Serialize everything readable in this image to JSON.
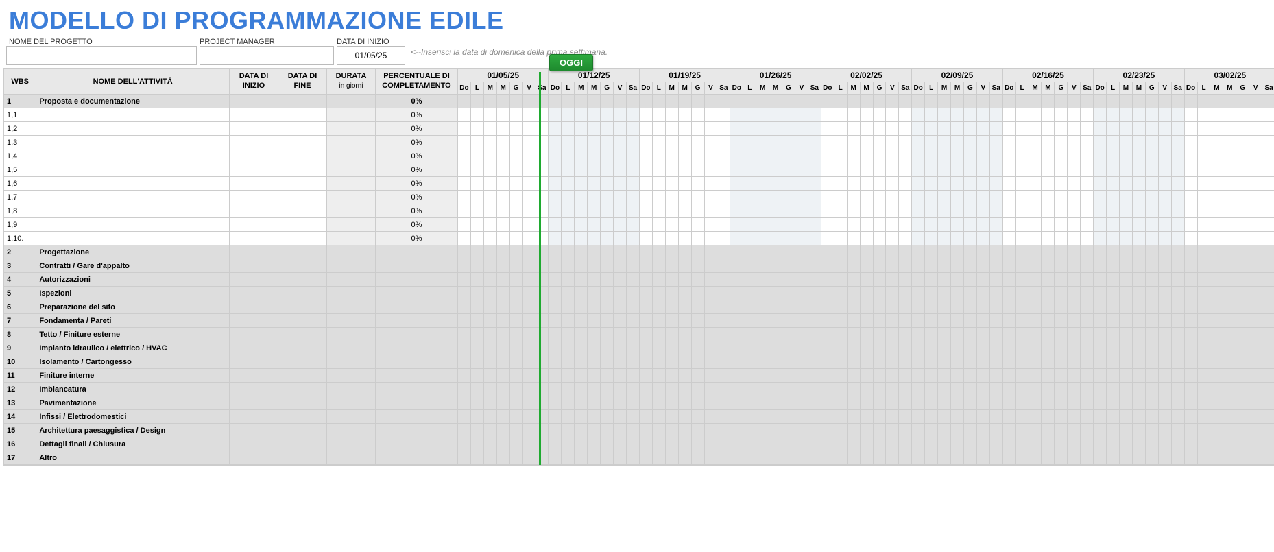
{
  "title": "MODELLO DI PROGRAMMAZIONE EDILE",
  "meta": {
    "project_name_label": "NOME DEL PROGETTO",
    "pm_label": "PROJECT MANAGER",
    "start_date_label": "DATA DI INIZIO",
    "project_name": "",
    "pm": "",
    "start_date": "01/05/25",
    "hint": "<--Inserisci la data di domenica della prima settimana."
  },
  "today_label": "OGGI",
  "headers": {
    "wbs": "WBS",
    "task": "NOME DELL'ATTIVITÀ",
    "start": "DATA DI INIZIO",
    "end": "DATA DI FINE",
    "dur_top": "DURATA",
    "dur_sub": "in giorni",
    "pct": "PERCENTUALE DI COMPLETAMENTO"
  },
  "weeks": [
    "01/05/25",
    "01/12/25",
    "01/19/25",
    "01/26/25",
    "02/02/25",
    "02/09/25",
    "02/16/25",
    "02/23/25",
    "03/02/25"
  ],
  "days": [
    "Do",
    "L",
    "M",
    "M",
    "G",
    "V",
    "Sa"
  ],
  "rows": [
    {
      "wbs": "1",
      "task": "Proposta e documentazione",
      "pct": "0%",
      "group": true
    },
    {
      "wbs": "1,1",
      "task": "",
      "pct": "0%",
      "group": false
    },
    {
      "wbs": "1,2",
      "task": "",
      "pct": "0%",
      "group": false
    },
    {
      "wbs": "1,3",
      "task": "",
      "pct": "0%",
      "group": false
    },
    {
      "wbs": "1,4",
      "task": "",
      "pct": "0%",
      "group": false
    },
    {
      "wbs": "1,5",
      "task": "",
      "pct": "0%",
      "group": false
    },
    {
      "wbs": "1,6",
      "task": "",
      "pct": "0%",
      "group": false
    },
    {
      "wbs": "1,7",
      "task": "",
      "pct": "0%",
      "group": false
    },
    {
      "wbs": "1,8",
      "task": "",
      "pct": "0%",
      "group": false
    },
    {
      "wbs": "1,9",
      "task": "",
      "pct": "0%",
      "group": false
    },
    {
      "wbs": "1.10.",
      "task": "",
      "pct": "0%",
      "group": false
    },
    {
      "wbs": "2",
      "task": "Progettazione",
      "pct": "",
      "group": true
    },
    {
      "wbs": "3",
      "task": "Contratti / Gare d'appalto",
      "pct": "",
      "group": true
    },
    {
      "wbs": "4",
      "task": "Autorizzazioni",
      "pct": "",
      "group": true
    },
    {
      "wbs": "5",
      "task": "Ispezioni",
      "pct": "",
      "group": true
    },
    {
      "wbs": "6",
      "task": "Preparazione del sito",
      "pct": "",
      "group": true
    },
    {
      "wbs": "7",
      "task": "Fondamenta / Pareti",
      "pct": "",
      "group": true
    },
    {
      "wbs": "8",
      "task": "Tetto / Finiture esterne",
      "pct": "",
      "group": true
    },
    {
      "wbs": "9",
      "task": "Impianto idraulico / elettrico / HVAC",
      "pct": "",
      "group": true
    },
    {
      "wbs": "10",
      "task": "Isolamento / Cartongesso",
      "pct": "",
      "group": true
    },
    {
      "wbs": "11",
      "task": "Finiture interne",
      "pct": "",
      "group": true
    },
    {
      "wbs": "12",
      "task": "Imbiancatura",
      "pct": "",
      "group": true
    },
    {
      "wbs": "13",
      "task": "Pavimentazione",
      "pct": "",
      "group": true
    },
    {
      "wbs": "14",
      "task": "Infissi / Elettrodomestici",
      "pct": "",
      "group": true
    },
    {
      "wbs": "15",
      "task": "Architettura paesaggistica / Design",
      "pct": "",
      "group": true
    },
    {
      "wbs": "16",
      "task": "Dettagli finali / Chiusura",
      "pct": "",
      "group": true
    },
    {
      "wbs": "17",
      "task": "Altro",
      "pct": "",
      "group": true
    }
  ]
}
